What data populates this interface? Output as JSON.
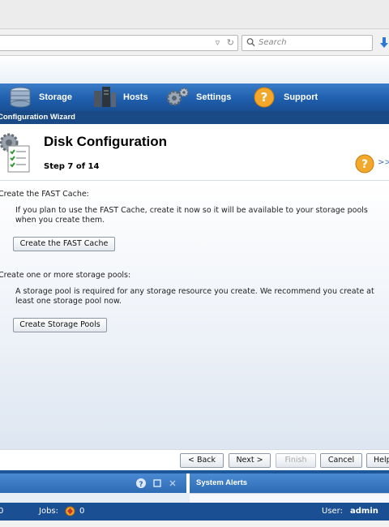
{
  "browser": {
    "search_placeholder": "Search"
  },
  "nav": {
    "items": [
      {
        "label": "Storage"
      },
      {
        "label": "Hosts"
      },
      {
        "label": "Settings"
      },
      {
        "label": "Support"
      }
    ]
  },
  "wizard": {
    "title_bar": "Configuration Wizard",
    "page_title": "Disk Configuration",
    "step": "Step 7 of 14",
    "more": ">>"
  },
  "sections": {
    "fast_cache": {
      "heading": "Create the FAST Cache:",
      "text": "If you plan to use the FAST Cache, create it now so it will be available to your storage pools when you create them.",
      "button": "Create the FAST Cache"
    },
    "storage_pools": {
      "heading": "Create one or more storage pools:",
      "text": "A storage pool is required for any storage resource you create. We recommend you create at least one storage pool now.",
      "button": "Create Storage Pools"
    }
  },
  "footer": {
    "back": "< Back",
    "next": "Next >",
    "finish": "Finish",
    "cancel": "Cancel",
    "help": "Help"
  },
  "bottom_panels": {
    "system_alerts": "System Alerts"
  },
  "status": {
    "left_value": "0",
    "jobs_label": "Jobs:",
    "jobs_value": "0",
    "user_label": "User:",
    "user_value": "admin"
  },
  "colors": {
    "nav_blue": "#1f5fae",
    "wizard_bar": "#1a4a86",
    "status_bar": "#1b4f93"
  }
}
